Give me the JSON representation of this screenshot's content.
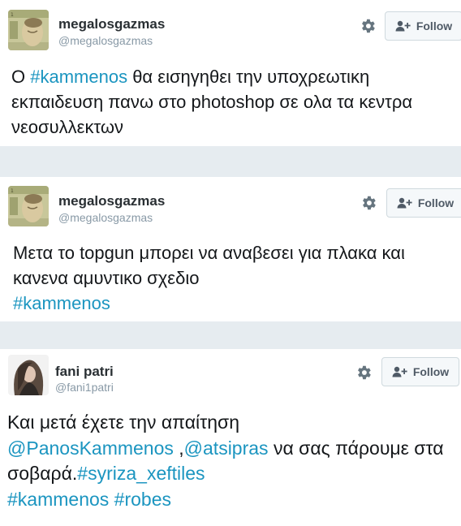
{
  "tweets": [
    {
      "author_name": "megalosgazmas",
      "author_handle": "@megalosgazmas",
      "avatar_icon": "drachma-banknote-avatar",
      "follow_label": "Follow",
      "text_segments": [
        {
          "text": "Ο ",
          "type": "plain"
        },
        {
          "text": "#kammenos",
          "type": "hashtag"
        },
        {
          "text": " θα εισηγηθει την υποχρεωτικη εκπαιδευση πανω στο photoshop σε ολα τα κεντρα νεοσυλλεκτων",
          "type": "plain"
        }
      ]
    },
    {
      "author_name": "megalosgazmas",
      "author_handle": "@megalosgazmas",
      "avatar_icon": "drachma-banknote-avatar",
      "follow_label": "Follow",
      "text_segments": [
        {
          "text": "Μετα το topgun μπορει να αναβεσει για πλακα και κανενα αμυντικο σχεδιο",
          "type": "plain"
        },
        {
          "text": "#kammenos",
          "type": "hashtag"
        }
      ]
    },
    {
      "author_name": "fani patri",
      "author_handle": "@fani1patri",
      "avatar_icon": "woman-portrait-avatar",
      "follow_label": "Follow",
      "text_segments": [
        {
          "text": "Και μετά έχετε την απαίτηση",
          "type": "plain"
        },
        {
          "text": "@PanosKammenos",
          "type": "mention"
        },
        {
          "text": " ,",
          "type": "plain"
        },
        {
          "text": "@atsipras",
          "type": "mention"
        },
        {
          "text": " να σας πάρουμε στα σοβαρά.",
          "type": "plain"
        },
        {
          "text": "#syriza_xeftiles",
          "type": "hashtag"
        },
        {
          "text": "#kammenos",
          "type": "hashtag"
        },
        {
          "text": " ",
          "type": "plain"
        },
        {
          "text": "#robes",
          "type": "hashtag"
        }
      ]
    }
  ],
  "colors": {
    "link": "#1b95c0",
    "background": "#e6ecf0",
    "handle": "#8899a6"
  }
}
